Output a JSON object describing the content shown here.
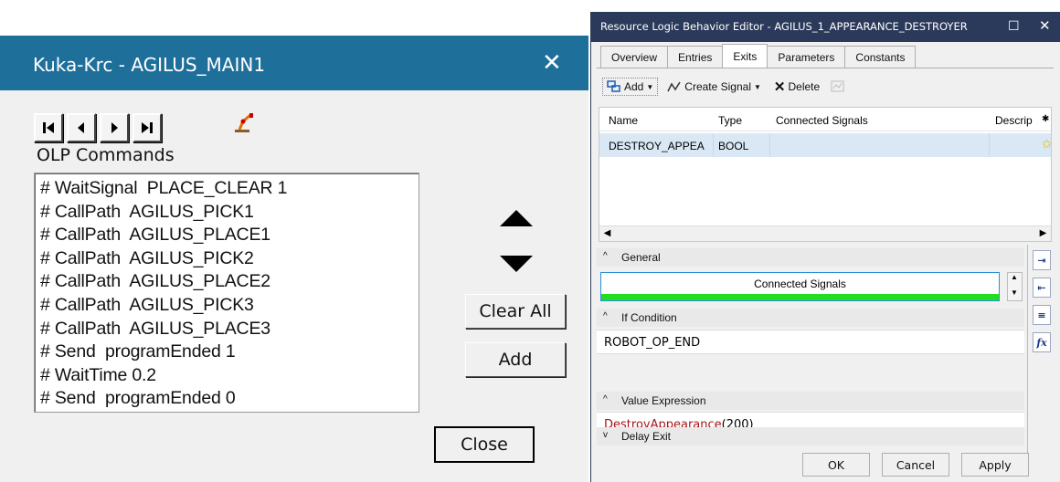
{
  "kuka_dialog": {
    "title": "Kuka-Krc - AGILUS_MAIN1",
    "close_icon": "close-icon",
    "nav_buttons": [
      "first-icon",
      "previous-icon",
      "next-icon",
      "last-icon",
      "robot-teach-icon"
    ],
    "olp_label": "OLP Commands",
    "commands": [
      "# WaitSignal  PLACE_CLEAR 1",
      "# CallPath  AGILUS_PICK1",
      "# CallPath  AGILUS_PLACE1",
      "# CallPath  AGILUS_PICK2",
      "# CallPath  AGILUS_PLACE2",
      "# CallPath  AGILUS_PICK3",
      "# CallPath  AGILUS_PLACE3",
      "# Send  programEnded 1",
      "# WaitTime 0.2",
      "# Send  programEnded 0"
    ],
    "clear_all_label": "Clear All",
    "add_label": "Add",
    "close_label": "Close",
    "colors": {
      "titlebar": "#1f6f9b"
    }
  },
  "rlbe_window": {
    "title": "Resource Logic Behavior Editor - AGILUS_1_APPEARANCE_DESTROYER",
    "tabs": [
      "Overview",
      "Entries",
      "Exits",
      "Parameters",
      "Constants"
    ],
    "active_tab": "Exits",
    "toolbar": {
      "add_label": "Add",
      "create_signal_label": "Create Signal",
      "delete_label": "Delete"
    },
    "grid": {
      "columns": [
        "Name",
        "Type",
        "Connected Signals",
        "Descrip"
      ],
      "rows": [
        {
          "name": "DESTROY_APPEA",
          "type": "BOOL",
          "connected": "",
          "description": ""
        }
      ]
    },
    "sections": {
      "general": "General",
      "connected_signals_header": "Connected Signals",
      "if_condition": "If Condition",
      "if_condition_value": "ROBOT_OP_END",
      "value_expression": "Value Expression",
      "value_expression_func": "DestroyAppearance",
      "value_expression_args": "(200)",
      "delay_exit": "Delay Exit"
    },
    "sidebar_icons": [
      "entry-icon",
      "exit-icon",
      "signal-icon",
      "function-icon"
    ],
    "function_icon_label": "fx",
    "buttons": {
      "ok": "OK",
      "cancel": "Cancel",
      "apply": "Apply"
    },
    "colors": {
      "titlebar": "#2b3a5a",
      "selected_row": "#d9e8f4",
      "green_bar": "#22dd22",
      "function_text": "#a31515"
    }
  }
}
